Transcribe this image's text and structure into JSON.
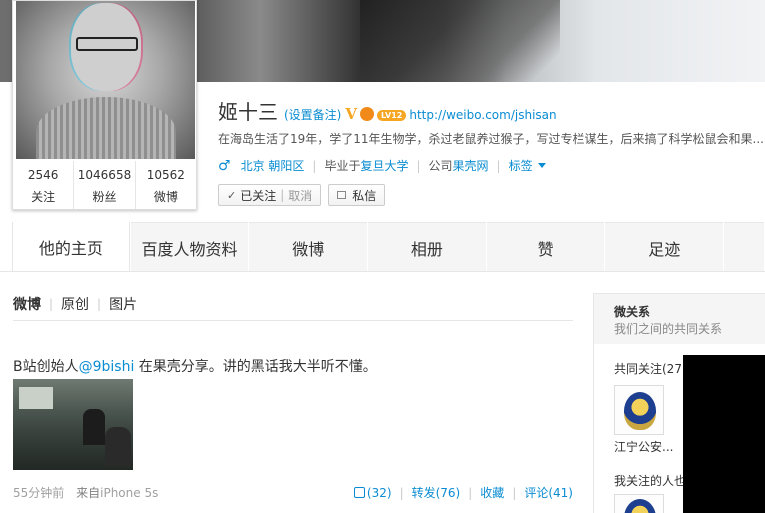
{
  "profile": {
    "name": "姬十三",
    "remark": "(设置备注)",
    "verified_mark": "V",
    "level_badge": "LV12",
    "homepage_url": "http://weibo.com/jshisan",
    "bio": "在海岛生活了19年，学了11年生物学，杀过老鼠养过猴子，写过专栏谋生，后来搞了科学松鼠会和果...",
    "gender_icon": "♂",
    "location": "北京 朝阳区",
    "education_prefix": "毕业于",
    "school": "复旦大学",
    "company_prefix": "公司",
    "company": "果壳网",
    "tags_label": "标签",
    "stats": [
      {
        "value": "2546",
        "label": "关注"
      },
      {
        "value": "1046658",
        "label": "粉丝"
      },
      {
        "value": "10562",
        "label": "微博"
      }
    ],
    "followed_label": "已关注",
    "unfollow_label": "取消",
    "message_label": "私信"
  },
  "tabs": [
    "他的主页",
    "百度人物资料",
    "微博",
    "相册",
    "赞",
    "足迹"
  ],
  "feed": {
    "subnav": [
      "微博",
      "原创",
      "图片"
    ],
    "post": {
      "text_before": "B站创始人",
      "mention": "@9bishi",
      "text_after": " 在果壳分享。讲的黑话我大半听不懂。",
      "time": "55分钟前",
      "source_label": "来自",
      "source": "iPhone 5s",
      "like_count": "(32)",
      "repost": "转发(76)",
      "favorite": "收藏",
      "comment": "评论(41)"
    }
  },
  "side": {
    "title": "微关系",
    "subtitle": "我们之间的共同关系",
    "common_follow": "共同关注(27)",
    "common_user": "江宁公安...",
    "also_follow": "我关注的人也"
  },
  "colors": {
    "link": "#0a8cd2",
    "verified": "#f6a623"
  }
}
